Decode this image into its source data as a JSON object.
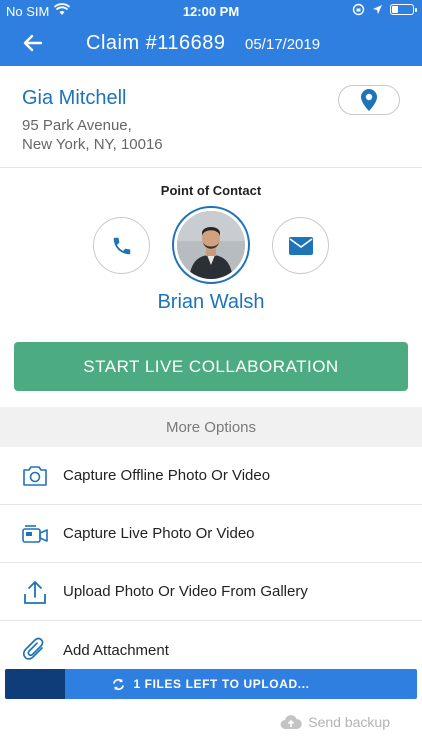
{
  "status_bar": {
    "carrier": "No SIM",
    "time": "12:00 PM"
  },
  "header": {
    "title": "Claim #116689",
    "date": "05/17/2019",
    "background_color": "#2f7fe0"
  },
  "customer": {
    "name": "Gia Mitchell",
    "address_line1": "95 Park Avenue,",
    "address_line2": "New York, NY, 10016"
  },
  "contact": {
    "section_label": "Point of Contact",
    "name": "Brian Walsh"
  },
  "actions": {
    "collaboration_label": "START LIVE COLLABORATION",
    "collaboration_color": "#4dab82"
  },
  "more_options": {
    "label": "More Options",
    "items": [
      {
        "label": "Capture Offline Photo Or Video",
        "icon": "camera-icon"
      },
      {
        "label": "Capture Live Photo Or Video",
        "icon": "live-video-icon"
      },
      {
        "label": "Upload Photo Or Video From Gallery",
        "icon": "upload-icon"
      },
      {
        "label": "Add Attachment",
        "icon": "paperclip-icon"
      }
    ]
  },
  "upload": {
    "text": "1 FILES LEFT TO UPLOAD...",
    "progress_fraction": 0.145
  },
  "backup": {
    "label": "Send backup"
  },
  "colors": {
    "accent_blue": "#1f73b7",
    "upload_dark": "#0f3d7a"
  }
}
